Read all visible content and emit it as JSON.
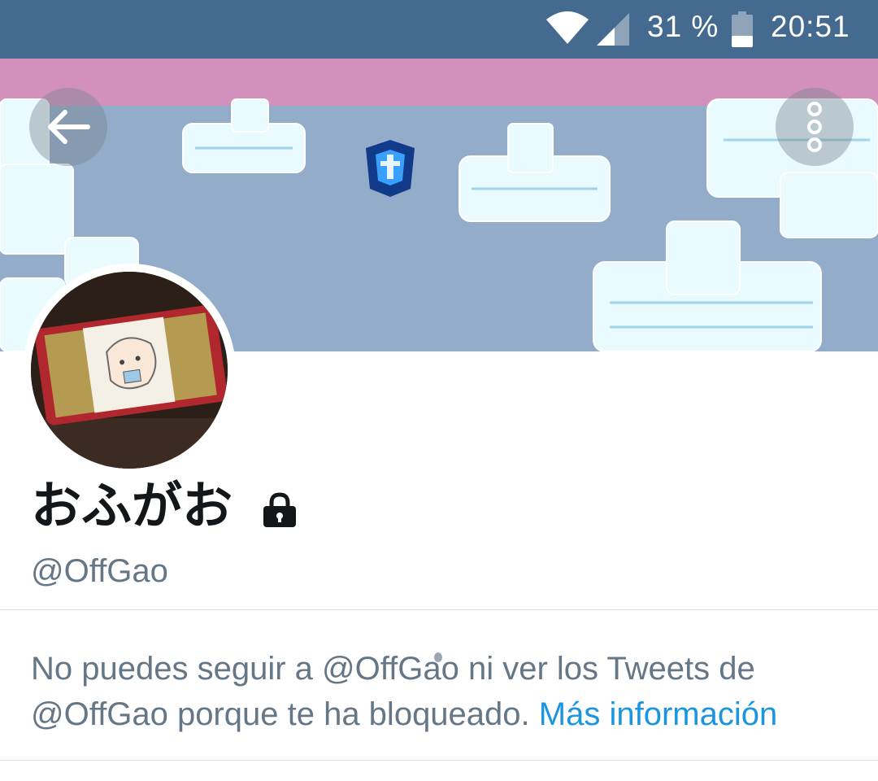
{
  "status_bar": {
    "battery_percent": "31 %",
    "time": "20:51",
    "icons": [
      "wifi-icon",
      "signal-icon",
      "battery-icon"
    ]
  },
  "header": {
    "back_icon": "arrow-left-icon",
    "more_icon": "more-vertical-icon"
  },
  "profile": {
    "display_name": "おふがお",
    "protected_icon": "lock-icon",
    "handle": "@OffGao"
  },
  "blocked_notice": {
    "line1": "No puedes seguir a @OffGao ni ver los Tweets de",
    "line2_prefix": "@OffGao porque te ha bloqueado.",
    "link_label": "Más información"
  },
  "colors": {
    "status_bar": "#456a90",
    "banner_sky": "#92acca",
    "banner_top": "#d191bc",
    "link": "#1b95e0",
    "secondary_text": "#657786"
  }
}
